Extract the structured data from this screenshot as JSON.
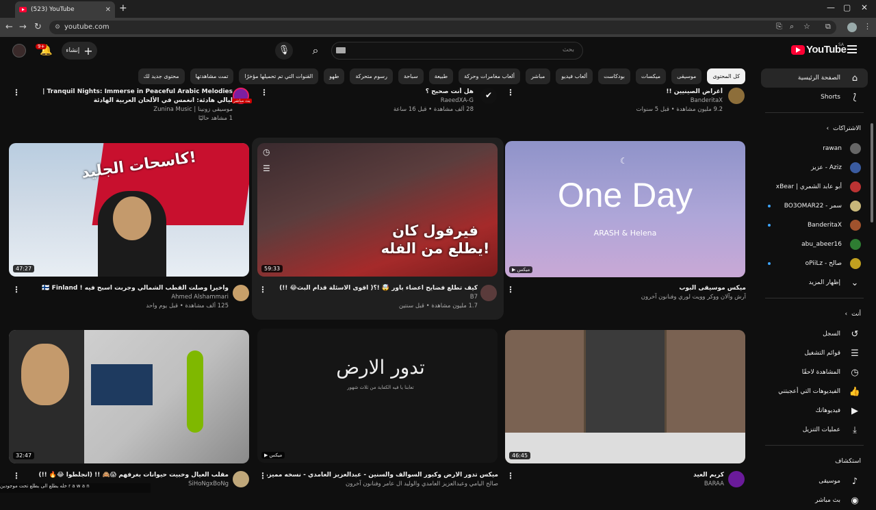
{
  "browser": {
    "tab_title": "(523) YouTube",
    "url": "youtube.com"
  },
  "masthead": {
    "logo": "YouTube",
    "region": "SA",
    "search_placeholder": "بحث",
    "create": "إنشاء",
    "notif_count": "9+"
  },
  "chips": [
    "كل المحتوى",
    "موسيقى",
    "ميكسات",
    "بودكاست",
    "ألعاب فيديو",
    "مباشر",
    "ألعاب مغامرات وحركة",
    "طبيعة",
    "سباحة",
    "رسوم متحركة",
    "طهو",
    "القنوات التي تم تحميلها مؤخرًا",
    "تمت مشاهدتها",
    "محتوى جديد لك"
  ],
  "sidebar": {
    "home": "الصفحة الرئيسية",
    "shorts": "Shorts",
    "subs_title": "الاشتراكات",
    "subs": [
      {
        "name": "rawan",
        "dot": false
      },
      {
        "name": "Aziz - عزيز",
        "dot": false
      },
      {
        "name": "أبو عابد الشمري | xBear",
        "dot": false
      },
      {
        "name": "سمر - BO3OMAR22",
        "dot": true
      },
      {
        "name": "BanderitaX",
        "dot": true
      },
      {
        "name": "abu_abeer16",
        "dot": false
      },
      {
        "name": "صالح - oPiiLz",
        "dot": true
      }
    ],
    "show_more": "إظهار المزيد",
    "you_title": "أنت",
    "you": [
      {
        "name": "السجل",
        "icon": "history-icon",
        "g": "↺"
      },
      {
        "name": "قوائم التشغيل",
        "icon": "playlists-icon",
        "g": "☰"
      },
      {
        "name": "المشاهدة لاحقًا",
        "icon": "clock-icon",
        "g": "◷"
      },
      {
        "name": "الفيديوهات التي أعجبتني",
        "icon": "like-icon",
        "g": "👍"
      },
      {
        "name": "فيديوهاتك",
        "icon": "your-videos-icon",
        "g": "▶"
      },
      {
        "name": "عمليات التنزيل",
        "icon": "download-icon",
        "g": "⤓"
      }
    ],
    "explore_title": "استكشاف",
    "explore": [
      {
        "name": "موسيقى",
        "icon": "music-icon",
        "g": "♪"
      },
      {
        "name": "بث مباشر",
        "icon": "live-icon",
        "g": "◉"
      }
    ]
  },
  "top_row": [
    {
      "title": "Tranquil Nights: Immerse in Peaceful Arabic Melodies | ليالي هادئة: انغمس في الألحان العربية الهادئة",
      "channel": "موسيقى زونينا | Zunina Music",
      "stats": "1 مشاهد حاليًا",
      "live": "بث مباشر"
    },
    {
      "title": "هل أنت صحيح ؟",
      "channel": "RaeedXA-G",
      "stats": "28 ألف مشاهدة • قبل 16 ساعة"
    },
    {
      "title": "أغراض الصينيين !!",
      "channel": "BanderitaX",
      "stats": "9.2 مليون مشاهدة • قبل 5 سنوات"
    }
  ],
  "videos": [
    {
      "title": "ميكس موسيقى البوب",
      "channel": "آرش وآلان ووكر وويت لوري وفنانون آخرون",
      "stats": "",
      "badge": "ميكس",
      "thumb_text": "One Day",
      "thumb_sub": "ARASH & Helena"
    },
    {
      "title": "كيف تطلع فضايح اعضاء باور 🤯 !؟( اقوى الاسئلة قدام البث😂 !!)",
      "channel": "B7",
      "stats": "1.7 مليون مشاهدة • قبل سنتين",
      "duration": "59:33",
      "thumb_text": "فيرفول كان يطلع من الفله!"
    },
    {
      "title": "واخيرا وصلت القطب الشمالي وجربت اسبح فيه ! 🇫🇮 Finland",
      "channel": "Ahmed Alshammari",
      "stats": "125 ألف مشاهدة • قبل يوم واحد",
      "duration": "47:27",
      "thumb_text": "كاسحات الجليد!"
    },
    {
      "title": "كريم العيد",
      "channel": "BARAA",
      "stats": "",
      "duration": "46:45"
    },
    {
      "title": "ميكس تدور الارض وكبور السوالف والسنين - عبدالعزيز العامدي - نسخه مميزه 👌",
      "channel": "صالح اليامي وعبدالعزيز العامدي والوليد ال عامر وفنانون آخرون",
      "stats": "",
      "badge": "ميكس",
      "thumb_text": "تدور الارض",
      "thumb_sub": "تعابنا يا فيه الكفاية من ثلاث شهور"
    },
    {
      "title": "مقلب العيال وخبيت حيوانات بغرفهم 😱🙈 !! (انجلطوا 😂🔥 !!)",
      "channel": "SiHoNgxBoNg",
      "stats": "",
      "duration": "32:47"
    }
  ],
  "taskbar": "خله يطلع الى يطلع تحت موجودين r a w a n"
}
